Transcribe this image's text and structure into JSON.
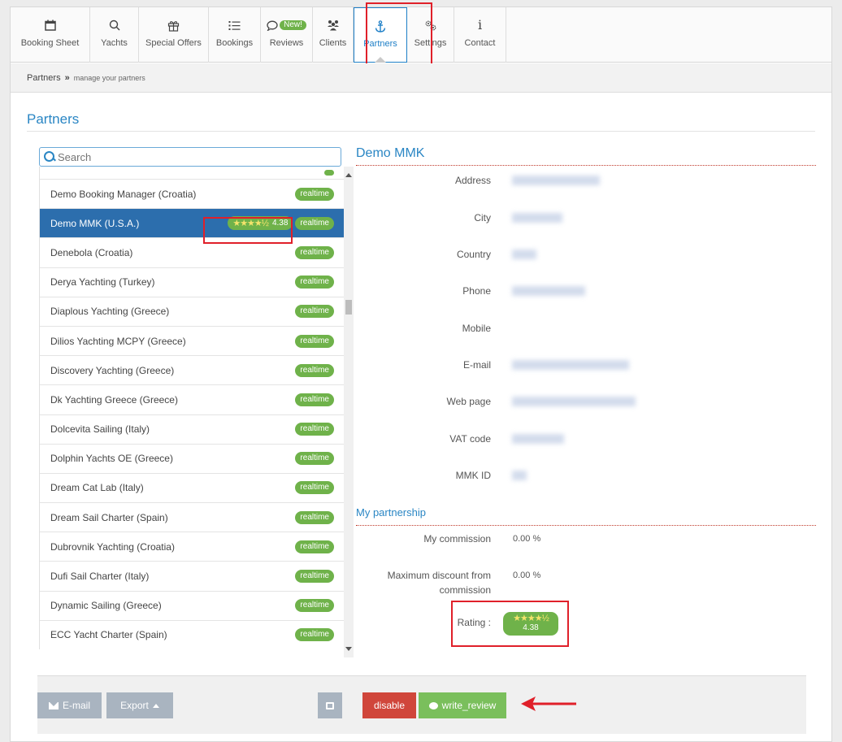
{
  "nav": {
    "items": [
      {
        "label": "Booking Sheet",
        "icon": "calendar-icon",
        "glyph": "🗓"
      },
      {
        "label": "Yachts",
        "icon": "search-icon",
        "glyph": "⚲"
      },
      {
        "label": "Special Offers",
        "icon": "gift-icon",
        "glyph": "🎁"
      },
      {
        "label": "Bookings",
        "icon": "list-icon",
        "glyph": "☰"
      },
      {
        "label": "Reviews",
        "icon": "speech-bubble-icon",
        "glyph": "💬",
        "badge": "New!"
      },
      {
        "label": "Clients",
        "icon": "users-icon",
        "glyph": "👥"
      },
      {
        "label": "Partners",
        "icon": "anchor-icon",
        "glyph": "⚓"
      },
      {
        "label": "Settings",
        "icon": "gears-icon",
        "glyph": "⚙"
      },
      {
        "label": "Contact",
        "icon": "info-icon",
        "glyph": "i"
      }
    ],
    "active": "Partners"
  },
  "breadcrumb": {
    "root": "Partners",
    "separator": "»",
    "sub": "manage your partners"
  },
  "page": {
    "title": "Partners"
  },
  "search": {
    "placeholder": "Search"
  },
  "partners": [
    {
      "name": "",
      "badge": "realtime",
      "partial": true
    },
    {
      "name": "Demo Booking Manager (Croatia)",
      "badge": "realtime"
    },
    {
      "name": "Demo MMK (U.S.A.)",
      "badge": "realtime",
      "selected": true,
      "rating": "4.38"
    },
    {
      "name": "Denebola (Croatia)",
      "badge": "realtime"
    },
    {
      "name": "Derya Yachting (Turkey)",
      "badge": "realtime"
    },
    {
      "name": "Diaplous Yachting (Greece)",
      "badge": "realtime"
    },
    {
      "name": "Dilios Yachting MCPY (Greece)",
      "badge": "realtime"
    },
    {
      "name": "Discovery Yachting (Greece)",
      "badge": "realtime"
    },
    {
      "name": "Dk Yachting Greece (Greece)",
      "badge": "realtime"
    },
    {
      "name": "Dolcevita Sailing (Italy)",
      "badge": "realtime"
    },
    {
      "name": "Dolphin Yachts OE (Greece)",
      "badge": "realtime"
    },
    {
      "name": "Dream Cat Lab (Italy)",
      "badge": "realtime"
    },
    {
      "name": "Dream Sail Charter (Spain)",
      "badge": "realtime"
    },
    {
      "name": "Dubrovnik Yachting (Croatia)",
      "badge": "realtime"
    },
    {
      "name": "Dufi Sail Charter (Italy)",
      "badge": "realtime"
    },
    {
      "name": "Dynamic Sailing (Greece)",
      "badge": "realtime"
    },
    {
      "name": "ECC Yacht Charter (Spain)",
      "badge": "realtime"
    }
  ],
  "detail": {
    "title": "Demo MMK",
    "fields": [
      {
        "label": "Address"
      },
      {
        "label": "City"
      },
      {
        "label": "Country"
      },
      {
        "label": "Phone"
      },
      {
        "label": "Mobile"
      },
      {
        "label": "E-mail"
      },
      {
        "label": "Web page"
      },
      {
        "label": "VAT code"
      },
      {
        "label": "MMK ID"
      }
    ],
    "partnership_title": "My partnership",
    "commission_label": "My commission",
    "commission_value": "0.00 %",
    "max_discount_label_1": "Maximum discount from",
    "max_discount_label_2": "commission",
    "max_discount_value": "0.00 %",
    "rating_label": "Rating :",
    "rating_value": "4.38",
    "stars": "★★★★½"
  },
  "toolbar": {
    "email_label": "E-mail",
    "export_label": "Export",
    "disable_label": "disable",
    "review_label": "write_review"
  },
  "colors": {
    "accent": "#2a86c4",
    "selected": "#2c6ead",
    "badge": "#6fb24a",
    "highlight": "#e0202a",
    "danger": "#d0463b",
    "success": "#7abf5c"
  }
}
